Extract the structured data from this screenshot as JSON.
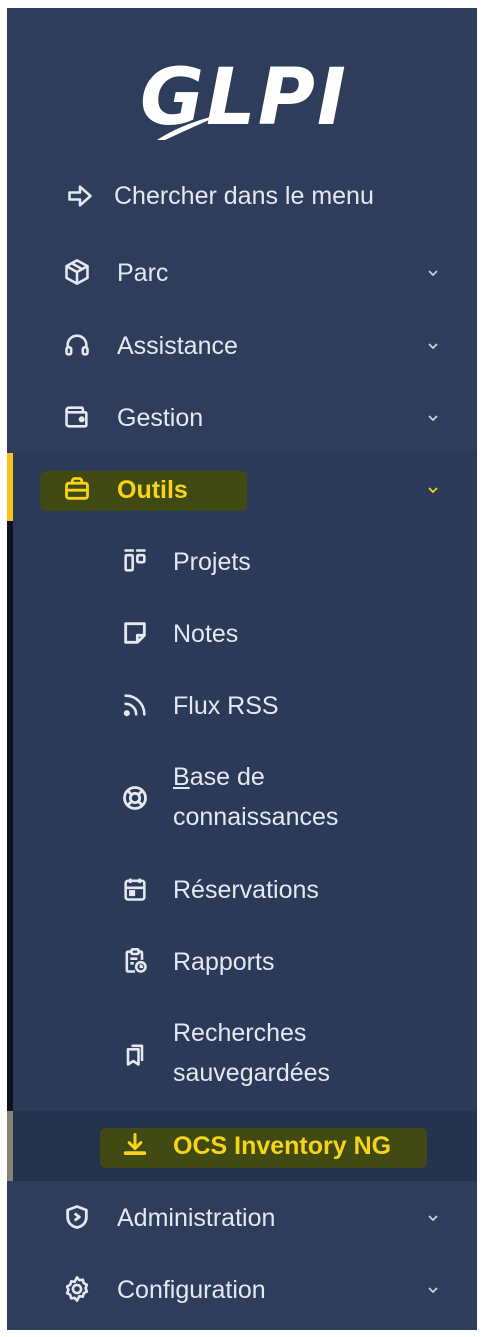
{
  "logo": {
    "text": "GLPI"
  },
  "menu": {
    "search": {
      "label": "Chercher dans le menu",
      "icon": "arrow-right-icon"
    },
    "items": [
      {
        "label": "Parc",
        "icon": "box-icon",
        "expanded": false
      },
      {
        "label": "Assistance",
        "icon": "headset-icon",
        "expanded": false
      },
      {
        "label": "Gestion",
        "icon": "wallet-icon",
        "expanded": false
      },
      {
        "label": "Outils",
        "icon": "briefcase-icon",
        "expanded": true,
        "active": true
      },
      {
        "label": "Administration",
        "icon": "shield-icon",
        "expanded": false
      },
      {
        "label": "Configuration",
        "icon": "gear-icon",
        "expanded": false
      }
    ],
    "submenu": [
      {
        "label": "Projets",
        "icon": "kanban-icon"
      },
      {
        "label": "Notes",
        "icon": "sticky-note-icon"
      },
      {
        "label": "Flux RSS",
        "icon": "rss-icon"
      },
      {
        "label_line1": "Base de",
        "label_line2": "connaissances",
        "icon": "lifebuoy-icon"
      },
      {
        "label": "Réservations",
        "icon": "calendar-icon"
      },
      {
        "label": "Rapports",
        "icon": "report-icon"
      },
      {
        "label_line1": "Recherches",
        "label_line2": "sauvegardées",
        "icon": "bookmarks-icon"
      },
      {
        "label": "OCS Inventory NG",
        "icon": "download-icon",
        "active": true
      }
    ]
  },
  "colors": {
    "sidebar_bg": "#2f3d5d",
    "submenu_bg": "#2b3a58",
    "active_yellow": "#f7d415",
    "highlight": "#404a12",
    "text": "#e4e8f1"
  }
}
